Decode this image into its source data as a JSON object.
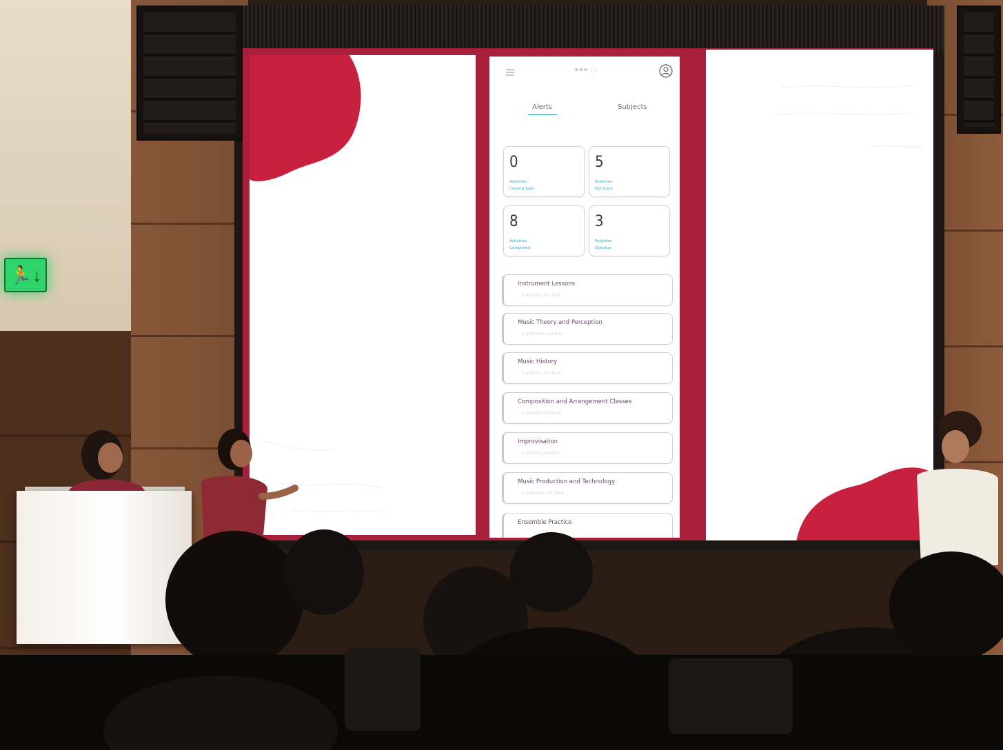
{
  "app": {
    "tabs": [
      {
        "label": "Alerts",
        "active": true
      },
      {
        "label": "Subjects",
        "active": false
      }
    ],
    "stats": [
      {
        "value": "0",
        "line1": "Activities",
        "line2": "Coming Soon"
      },
      {
        "value": "5",
        "line1": "Activities",
        "line2": "Not Done"
      },
      {
        "value": "8",
        "line1": "Activities",
        "line2": "Completed"
      },
      {
        "value": "3",
        "line1": "Activities",
        "line2": "Overdue"
      }
    ],
    "subjects": [
      {
        "name": "Instrument Lessons",
        "detail": "1 activity not done"
      },
      {
        "name": "Music Theory and Perception",
        "detail": "2 activities overdue"
      },
      {
        "name": "Music History",
        "detail": "1 activity not done"
      },
      {
        "name": "Composition and Arrangement Classes",
        "detail": "1 activity not done"
      },
      {
        "name": "Improvisation",
        "detail": "1 activity overdue"
      },
      {
        "name": "Music Production and Technology",
        "detail": "2 activities not done"
      },
      {
        "name": "Ensemble Practice",
        "detail": ""
      }
    ]
  },
  "colors": {
    "brand_red": "#c8213f",
    "accent_teal": "#1a9aa3",
    "exit_green": "#2fd56a"
  },
  "icons": {
    "menu": "hamburger-icon",
    "profile": "user-circle-icon",
    "exit": "emergency-exit-icon"
  }
}
